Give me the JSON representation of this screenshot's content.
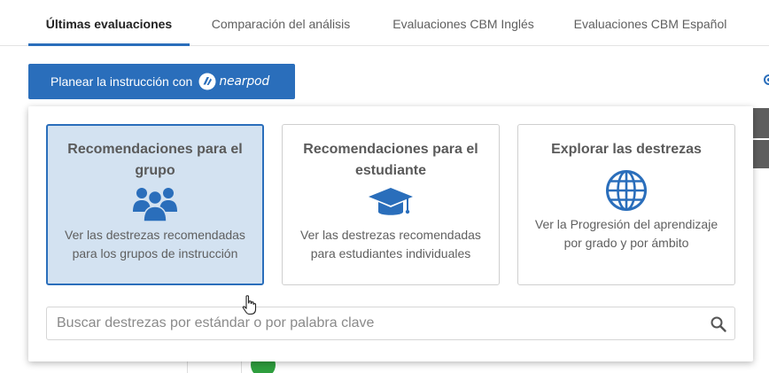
{
  "tabs": [
    {
      "label": "Últimas evaluaciones",
      "active": true
    },
    {
      "label": "Comparación del análisis",
      "active": false
    },
    {
      "label": "Evaluaciones CBM Inglés",
      "active": false
    },
    {
      "label": "Evaluaciones CBM Español",
      "active": false
    }
  ],
  "nearpod_button": {
    "label": "Planear la instrucción con",
    "brand": "nearpod"
  },
  "panel": {
    "cards": [
      {
        "title": "Recomendaciones para el grupo",
        "description": "Ver las destrezas recomendadas para los grupos de instrucción",
        "icon": "group-icon",
        "selected": true
      },
      {
        "title": "Recomendaciones para el estudiante",
        "description": "Ver las destrezas recomendadas para estudiantes individuales",
        "icon": "graduation-cap-icon",
        "selected": false
      },
      {
        "title": "Explorar las destrezas",
        "description": "Ver la Progresión del aprendizaje por grado y por ámbito",
        "icon": "globe-icon",
        "selected": false
      }
    ],
    "search": {
      "placeholder": "Buscar destrezas por estándar o por palabra clave",
      "value": ""
    }
  },
  "colors": {
    "accent": "#2a6ebb",
    "selected_card_bg": "#d3e2f1",
    "icon_blue": "#2a6ebb",
    "status_green": "#2e9e3e"
  }
}
